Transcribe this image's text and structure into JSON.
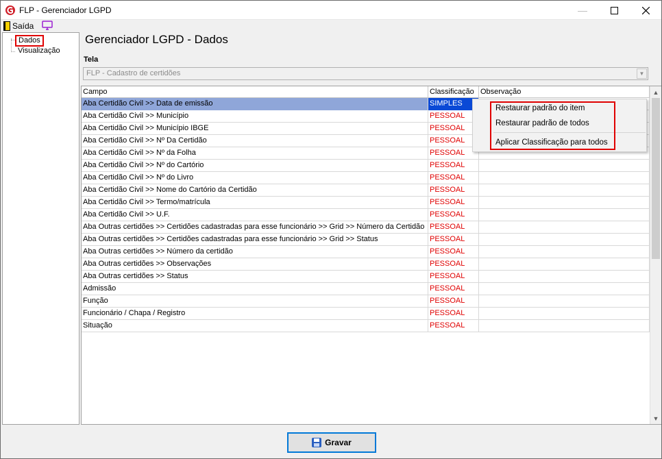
{
  "window": {
    "title": "FLP - Gerenciador LGPD"
  },
  "menu": {
    "exit_label": "Saída"
  },
  "tree": {
    "items": [
      {
        "label": "Dados"
      },
      {
        "label": "Visualização"
      }
    ]
  },
  "main": {
    "title": "Gerenciador LGPD - Dados",
    "tela_label": "Tela",
    "tela_value": "FLP - Cadastro de certidões"
  },
  "grid": {
    "columns": [
      "Campo",
      "Classificação",
      "Observação"
    ],
    "rows": [
      {
        "campo": "Aba Certidão Civil >> Data de emissão",
        "classificacao": "SIMPLES",
        "observacao": ""
      },
      {
        "campo": "Aba Certidão Civil >> Município",
        "classificacao": "PESSOAL",
        "observacao": ""
      },
      {
        "campo": "Aba Certidão Civil >> Município IBGE",
        "classificacao": "PESSOAL",
        "observacao": ""
      },
      {
        "campo": "Aba Certidão Civil >> Nº Da Certidão",
        "classificacao": "PESSOAL",
        "observacao": ""
      },
      {
        "campo": "Aba Certidão Civil >> Nº da Folha",
        "classificacao": "PESSOAL",
        "observacao": ""
      },
      {
        "campo": "Aba Certidão Civil >> Nº do Cartório",
        "classificacao": "PESSOAL",
        "observacao": ""
      },
      {
        "campo": "Aba Certidão Civil >> Nº do Livro",
        "classificacao": "PESSOAL",
        "observacao": ""
      },
      {
        "campo": "Aba Certidão Civil >> Nome do Cartório da Certidão",
        "classificacao": "PESSOAL",
        "observacao": ""
      },
      {
        "campo": "Aba Certidão Civil >> Termo/matrícula",
        "classificacao": "PESSOAL",
        "observacao": ""
      },
      {
        "campo": "Aba Certidão Civil >> U.F.",
        "classificacao": "PESSOAL",
        "observacao": ""
      },
      {
        "campo": "Aba Outras certidões >> Certidões cadastradas para esse funcionário >> Grid >> Número da Certidão",
        "classificacao": "PESSOAL",
        "observacao": ""
      },
      {
        "campo": "Aba Outras certidões >> Certidões cadastradas para esse funcionário >> Grid >> Status",
        "classificacao": "PESSOAL",
        "observacao": ""
      },
      {
        "campo": "Aba Outras certidões >> Número da certidão",
        "classificacao": "PESSOAL",
        "observacao": ""
      },
      {
        "campo": "Aba Outras certidões >> Observações",
        "classificacao": "PESSOAL",
        "observacao": ""
      },
      {
        "campo": "Aba Outras certidões >> Status",
        "classificacao": "PESSOAL",
        "observacao": ""
      },
      {
        "campo": "Admissão",
        "classificacao": "PESSOAL",
        "observacao": ""
      },
      {
        "campo": "Função",
        "classificacao": "PESSOAL",
        "observacao": ""
      },
      {
        "campo": "Funcionário / Chapa / Registro",
        "classificacao": "PESSOAL",
        "observacao": ""
      },
      {
        "campo": "Situação",
        "classificacao": "PESSOAL",
        "observacao": ""
      }
    ]
  },
  "context_menu": {
    "items": [
      "Restaurar padrão do item",
      "Restaurar padrão de todos",
      "Aplicar Classificação para todos"
    ]
  },
  "footer": {
    "save_label": "Gravar"
  },
  "colors": {
    "pessoal": "#e00000",
    "selected_cell": "#0a49d6",
    "selected_row": "#8fa6d9",
    "highlight_box": "#e00000"
  }
}
